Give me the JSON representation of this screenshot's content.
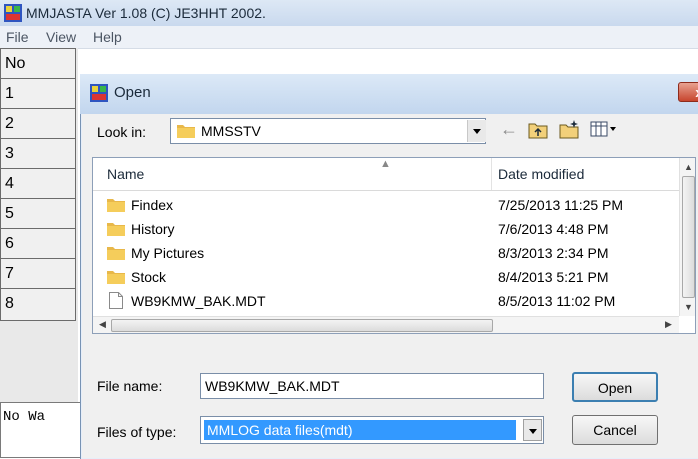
{
  "main_window": {
    "title": "MMJASTA Ver 1.08 (C) JE3HHT 2002.",
    "menu": [
      "File",
      "View",
      "Help"
    ],
    "grid_header": "No",
    "grid_rows": [
      "1",
      "2",
      "3",
      "4",
      "5",
      "6",
      "7",
      "8"
    ],
    "status_text": "No Wa"
  },
  "dialog": {
    "title": "Open",
    "close_label": "x",
    "look_in_label": "Look in:",
    "look_in_value": "MMSSTV",
    "columns": {
      "name": "Name",
      "date": "Date modified"
    },
    "files": [
      {
        "name": "Findex",
        "date": "7/25/2013 11:25 PM",
        "type": "folder"
      },
      {
        "name": "History",
        "date": "7/6/2013 4:48 PM",
        "type": "folder"
      },
      {
        "name": "My Pictures",
        "date": "8/3/2013 2:34 PM",
        "type": "folder"
      },
      {
        "name": "Stock",
        "date": "8/4/2013 5:21 PM",
        "type": "folder"
      },
      {
        "name": "WB9KMW_BAK.MDT",
        "date": "8/5/2013 11:02 PM",
        "type": "file"
      }
    ],
    "file_name_label": "File name:",
    "file_name_value": "WB9KMW_BAK.MDT",
    "file_type_label": "Files of type:",
    "file_type_value": "MMLOG data files(mdt)",
    "open_button": "Open",
    "cancel_button": "Cancel"
  },
  "colors": {
    "selection": "#3399ff",
    "titlebar": "#c9d9ee",
    "close": "#c7452e",
    "folder": "#e8b84a"
  }
}
